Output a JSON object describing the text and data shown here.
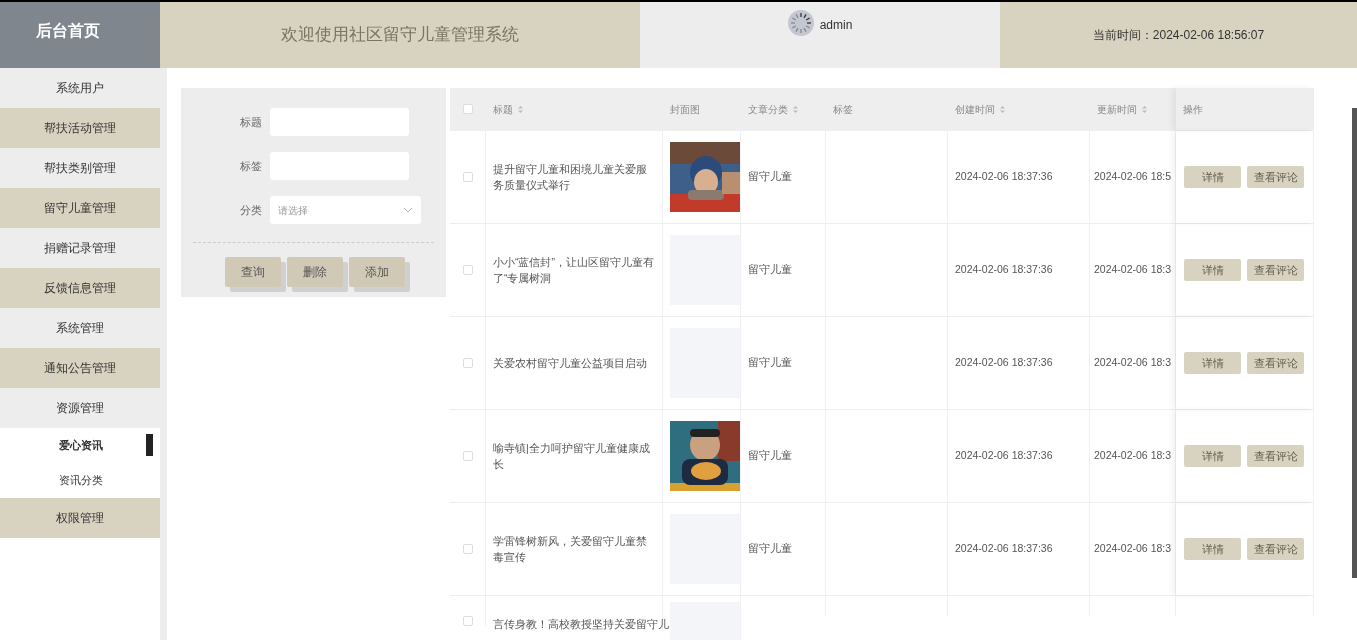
{
  "header": {
    "home": "后台首页",
    "title": "欢迎使用社区留守儿童管理系统",
    "user": "admin",
    "time": "当前时间：2024-02-06 18:56:07"
  },
  "sidebar": {
    "items": [
      {
        "label": "系统用户"
      },
      {
        "label": "帮扶活动管理"
      },
      {
        "label": "帮扶类别管理"
      },
      {
        "label": "留守儿童管理"
      },
      {
        "label": "捐赠记录管理"
      },
      {
        "label": "反馈信息管理"
      },
      {
        "label": "系统管理"
      },
      {
        "label": "通知公告管理"
      },
      {
        "label": "资源管理",
        "expanded": true,
        "children": [
          {
            "label": "爱心资讯",
            "selected": true
          },
          {
            "label": "资讯分类",
            "selected": false
          }
        ]
      },
      {
        "label": "权限管理"
      }
    ]
  },
  "search": {
    "fields": [
      {
        "label": "标题",
        "kind": "text"
      },
      {
        "label": "标签",
        "kind": "text"
      },
      {
        "label": "分类",
        "kind": "select",
        "placeholder": "请选择"
      }
    ],
    "buttons": [
      "查询",
      "删除",
      "添加"
    ]
  },
  "table": {
    "select_all_checked": false,
    "columns": [
      {
        "label": "标题",
        "sortable": true
      },
      {
        "label": "封面图",
        "sortable": false
      },
      {
        "label": "文章分类",
        "sortable": true
      },
      {
        "label": "标签",
        "sortable": false
      },
      {
        "label": "创建时间",
        "sortable": true
      },
      {
        "label": "更新时间",
        "sortable": true
      },
      {
        "label": "操作",
        "sortable": false
      }
    ],
    "rows": [
      {
        "checked": false,
        "title": "提升留守儿童和困境儿童关爱服务质量仪式举行",
        "has_cover": true,
        "category": "留守儿童",
        "created": "2024-02-06 18:37:36",
        "updated": "2024-02-06 18:5",
        "actions": [
          "详情",
          "查看评论"
        ]
      },
      {
        "checked": false,
        "title": "小小“蓝信封”，让山区留守儿童有了“专属树洞",
        "has_cover": false,
        "category": "留守儿童",
        "created": "2024-02-06 18:37:36",
        "updated": "2024-02-06 18:3",
        "actions": [
          "详情",
          "查看评论"
        ]
      },
      {
        "checked": false,
        "title": "关爱农村留守儿童公益项目启动",
        "has_cover": false,
        "category": "留守儿童",
        "created": "2024-02-06 18:37:36",
        "updated": "2024-02-06 18:3",
        "actions": [
          "详情",
          "查看评论"
        ]
      },
      {
        "checked": false,
        "title": "喻寺镇|全力呵护留守儿童健康成长",
        "has_cover": true,
        "category": "留守儿童",
        "created": "2024-02-06 18:37:36",
        "updated": "2024-02-06 18:3",
        "actions": [
          "详情",
          "查看评论"
        ]
      },
      {
        "checked": false,
        "title": "学雷锋树新风，关爱留守儿童禁毒宣传",
        "has_cover": false,
        "category": "留守儿童",
        "created": "2024-02-06 18:37:36",
        "updated": "2024-02-06 18:3",
        "actions": [
          "详情",
          "查看评论"
        ]
      },
      {
        "checked": false,
        "title": "言传身教！高校教授坚持关爱留守儿",
        "has_cover": false
      }
    ]
  }
}
